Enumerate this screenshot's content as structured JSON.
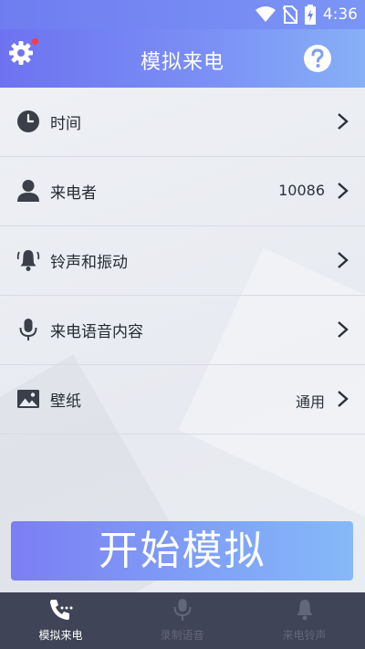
{
  "status_bar": {
    "time": "4:36"
  },
  "header": {
    "title": "模拟来电"
  },
  "settings": [
    {
      "label": "时间",
      "value": ""
    },
    {
      "label": "来电者",
      "value": "10086"
    },
    {
      "label": "铃声和振动",
      "value": ""
    },
    {
      "label": "来电语音内容",
      "value": ""
    },
    {
      "label": "壁纸",
      "value": "通用"
    }
  ],
  "start_button": {
    "label": "开始模拟"
  },
  "tabs": [
    {
      "label": "模拟来电",
      "active": true
    },
    {
      "label": "录制语音",
      "active": false
    },
    {
      "label": "来电铃声",
      "active": false
    }
  ],
  "colors": {
    "accent": "#7b8cf5",
    "tabbar": "#3f4456",
    "tab_inactive": "#626779"
  }
}
